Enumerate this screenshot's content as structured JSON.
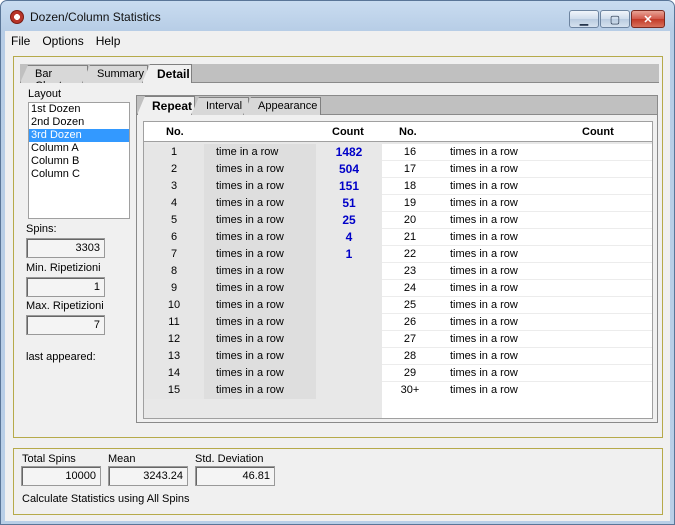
{
  "window": {
    "title": "Dozen/Column Statistics"
  },
  "menu": [
    "File",
    "Options",
    "Help"
  ],
  "tabs": [
    "Bar Chart",
    "Summary",
    "Detail"
  ],
  "layout": {
    "label": "Layout",
    "items": [
      "1st Dozen",
      "2nd Dozen",
      "3rd Dozen",
      "Column A",
      "Column B",
      "Column C"
    ],
    "selected": "3rd Dozen"
  },
  "stats": {
    "spins_label": "Spins:",
    "spins_value": "3303",
    "min_label": "Min. Ripetizioni",
    "min_value": "1",
    "max_label": "Max. Ripetizioni",
    "max_value": "7",
    "last_label": "last appeared:"
  },
  "inner_tabs": [
    "Repeat",
    "Interval",
    "Appearance"
  ],
  "table": {
    "headers": {
      "no": "No.",
      "count": "Count",
      "no2": "No.",
      "count2": "Count"
    },
    "left": [
      {
        "no": "1",
        "text": "time in a row",
        "count": "1482"
      },
      {
        "no": "2",
        "text": "times in a row",
        "count": "504"
      },
      {
        "no": "3",
        "text": "times in a row",
        "count": "151"
      },
      {
        "no": "4",
        "text": "times in a row",
        "count": "51"
      },
      {
        "no": "5",
        "text": "times in a row",
        "count": "25"
      },
      {
        "no": "6",
        "text": "times in a row",
        "count": "4"
      },
      {
        "no": "7",
        "text": "times in a row",
        "count": "1"
      },
      {
        "no": "8",
        "text": "times in a row",
        "count": ""
      },
      {
        "no": "9",
        "text": "times in a row",
        "count": ""
      },
      {
        "no": "10",
        "text": "times in a row",
        "count": ""
      },
      {
        "no": "11",
        "text": "times in a row",
        "count": ""
      },
      {
        "no": "12",
        "text": "times in a row",
        "count": ""
      },
      {
        "no": "13",
        "text": "times in a row",
        "count": ""
      },
      {
        "no": "14",
        "text": "times in a row",
        "count": ""
      },
      {
        "no": "15",
        "text": "times in a row",
        "count": ""
      }
    ],
    "right": [
      {
        "no": "16",
        "text": "times in a row",
        "count": ""
      },
      {
        "no": "17",
        "text": "times in a row",
        "count": ""
      },
      {
        "no": "18",
        "text": "times in a row",
        "count": ""
      },
      {
        "no": "19",
        "text": "times in a row",
        "count": ""
      },
      {
        "no": "20",
        "text": "times in a row",
        "count": ""
      },
      {
        "no": "21",
        "text": "times in a row",
        "count": ""
      },
      {
        "no": "22",
        "text": "times in a row",
        "count": ""
      },
      {
        "no": "23",
        "text": "times in a row",
        "count": ""
      },
      {
        "no": "24",
        "text": "times in a row",
        "count": ""
      },
      {
        "no": "25",
        "text": "times in a row",
        "count": ""
      },
      {
        "no": "26",
        "text": "times in a row",
        "count": ""
      },
      {
        "no": "27",
        "text": "times in a row",
        "count": ""
      },
      {
        "no": "28",
        "text": "times in a row",
        "count": ""
      },
      {
        "no": "29",
        "text": "times in a row",
        "count": ""
      },
      {
        "no": "30+",
        "text": "times in a row",
        "count": ""
      }
    ]
  },
  "footer": {
    "total_label": "Total Spins",
    "total_value": "10000",
    "mean_label": "Mean",
    "mean_value": "3243.24",
    "std_label": "Std. Deviation",
    "std_value": "46.81",
    "note": "Calculate Statistics using All Spins"
  },
  "colors": {
    "count_text": "#0000c8",
    "selection": "#3399ff",
    "group_border": "#b6aa4a"
  }
}
